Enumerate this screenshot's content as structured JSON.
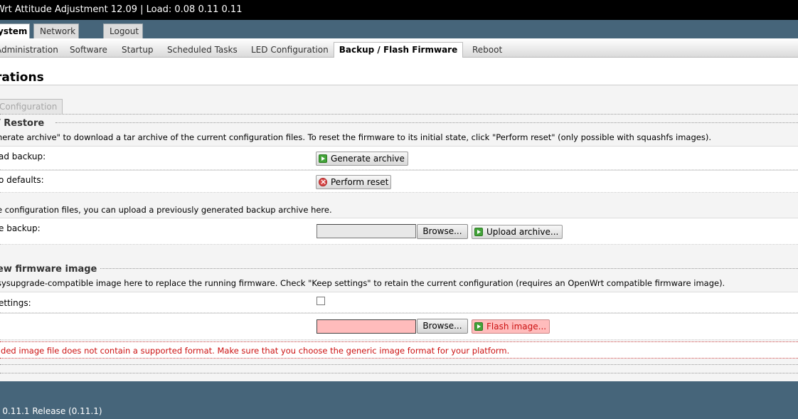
{
  "header": {
    "title": "Wrt Attitude Adjustment 12.09 | Load: 0.08 0.11 0.11"
  },
  "top_tabs": {
    "system": "ystem",
    "network": "Network",
    "logout": "Logout"
  },
  "subnav": {
    "items": [
      "Administration",
      "Software",
      "Startup",
      "Scheduled Tasks",
      "LED Configuration",
      "Backup / Flash Firmware",
      "Reboot"
    ],
    "active": "Backup / Flash Firmware"
  },
  "page": {
    "title": "rations",
    "config_tab": "Configuration"
  },
  "backup_section": {
    "legend": "/ Restore",
    "description": "nerate archive\" to download a tar archive of the current configuration files. To reset the firmware to its initial state, click \"Perform reset\" (only possible with squashfs images).",
    "download_label": "ad backup:",
    "generate_button": "Generate archive",
    "reset_label": "o defaults:",
    "reset_button": "Perform reset",
    "restore_description": "e configuration files, you can upload a previously generated backup archive here.",
    "restore_label": "e backup:",
    "browse_button": "Browse...",
    "upload_button": "Upload archive..."
  },
  "flash_section": {
    "legend": "ew firmware image",
    "description": "sysupgrade-compatible image here to replace the running firmware. Check \"Keep settings\" to retain the current configuration (requires an OpenWrt compatible firmware image).",
    "keep_label": "ettings:",
    "browse_button": "Browse...",
    "flash_button": "Flash image...",
    "error": "aded image file does not contain a supported format. Make sure that you choose the generic image format for your platform."
  },
  "footer": {
    "text": "I 0.11.1 Release (0.11.1)"
  },
  "colors": {
    "header_bg": "#000000",
    "nav_bg": "#46657a",
    "error_text": "#cc1111",
    "error_input_bg": "#ffbcbc"
  }
}
